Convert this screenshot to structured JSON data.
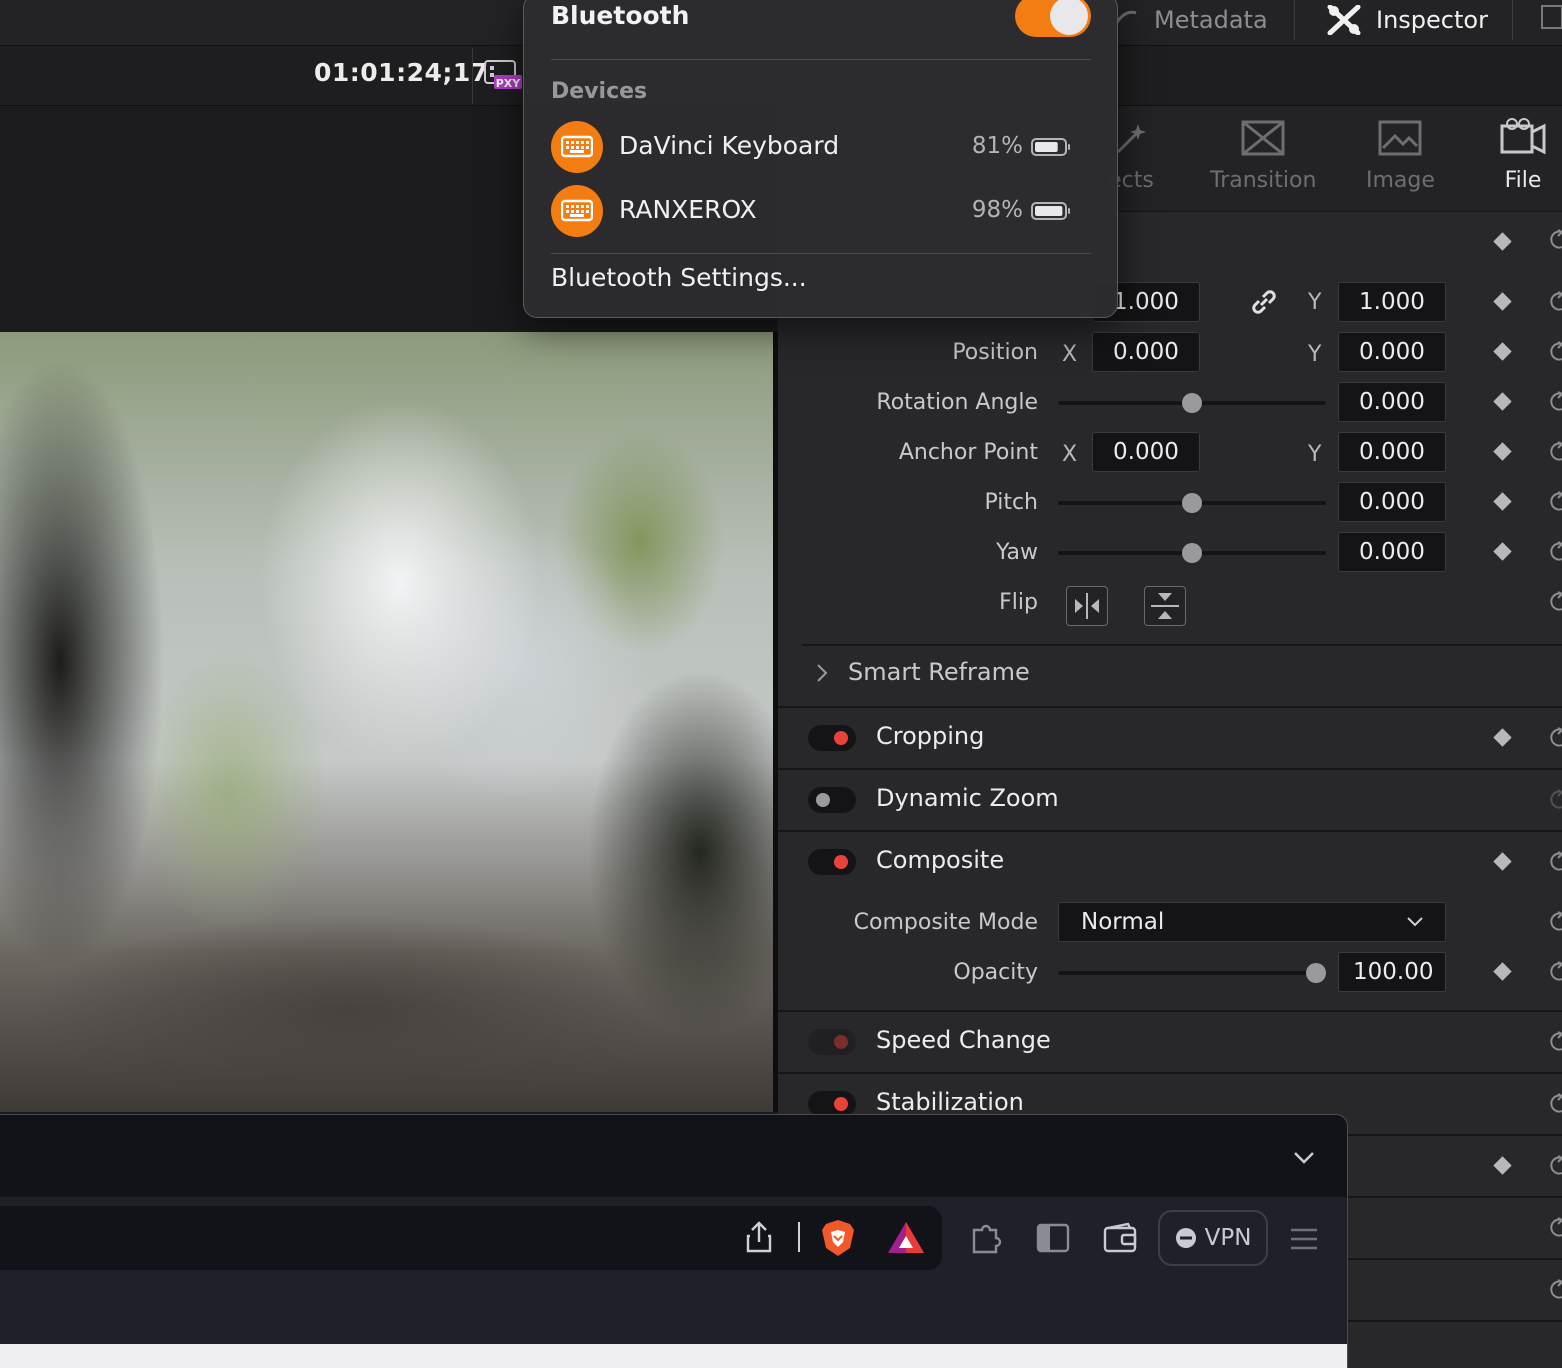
{
  "resolve": {
    "top_tabs": [
      {
        "label": "Metadata",
        "icon": "metadata-icon"
      },
      {
        "label": "Inspector",
        "icon": "inspector-icon"
      }
    ],
    "timecode": "01:01:24;17",
    "proxy_badge": "PXY"
  },
  "inspector": {
    "tabs": [
      {
        "label": "ects",
        "icon": "effects-icon"
      },
      {
        "label": "Transition",
        "icon": "transition-icon"
      },
      {
        "label": "Image",
        "icon": "image-icon"
      },
      {
        "label": "File",
        "icon": "file-icon",
        "active": true
      }
    ],
    "transform": {
      "zoom_x": "1.000",
      "zoom_y": "1.000",
      "position_label": "Position",
      "position_x": "0.000",
      "position_y": "0.000",
      "rotation_label": "Rotation Angle",
      "rotation": "0.000",
      "rotation_slider": 0.5,
      "anchor_label": "Anchor Point",
      "anchor_x": "0.000",
      "anchor_y": "0.000",
      "pitch_label": "Pitch",
      "pitch": "0.000",
      "pitch_slider": 0.5,
      "yaw_label": "Yaw",
      "yaw": "0.000",
      "yaw_slider": 0.5,
      "flip_label": "Flip",
      "x_axis": "X",
      "y_axis": "Y"
    },
    "sections": {
      "smart_reframe": "Smart Reframe",
      "cropping": "Cropping",
      "dynamic_zoom": "Dynamic Zoom",
      "composite": "Composite",
      "speed_change": "Speed Change",
      "stabilization": "Stabilization"
    },
    "composite": {
      "mode_label": "Composite Mode",
      "mode_value": "Normal",
      "opacity_label": "Opacity",
      "opacity_value": "100.00",
      "opacity_slider": 1.0
    },
    "colors": {
      "enabled_dot": "#e8423a",
      "disabled_dot": "#9a9a9e",
      "dim_dot": "#7a2e2a"
    }
  },
  "bluetooth": {
    "title": "Bluetooth",
    "enabled": true,
    "accent": "#f37c13",
    "devices_header": "Devices",
    "devices": [
      {
        "name": "DaVinci Keyboard",
        "battery": "81%",
        "battery_level": 0.81,
        "icon": "keyboard-icon"
      },
      {
        "name": "RANXEROX",
        "battery": "98%",
        "battery_level": 0.98,
        "icon": "keyboard-icon"
      }
    ],
    "settings_link": "Bluetooth Settings..."
  },
  "browser": {
    "vpn_label": "VPN",
    "icons": [
      "share-icon",
      "brave-shields-icon",
      "brave-rewards-icon",
      "extensions-icon",
      "sidebar-icon",
      "wallet-icon",
      "menu-icon",
      "tab-list-chevron-icon"
    ]
  }
}
